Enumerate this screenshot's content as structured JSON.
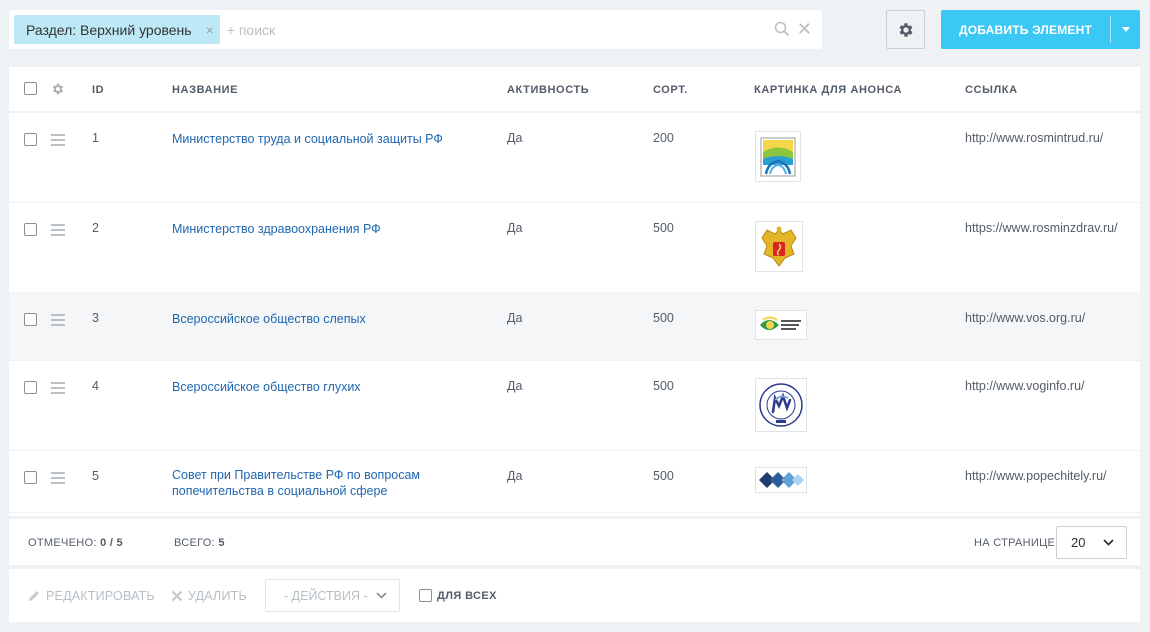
{
  "filter": {
    "chip_label": "Раздел: Верхний уровень",
    "chip_close": "×",
    "search_placeholder": "+ поиск",
    "clear": "✕"
  },
  "toolbar": {
    "add_label": "ДОБАВИТЬ ЭЛЕМЕНТ"
  },
  "columns": {
    "id": "ID",
    "name": "НАЗВАНИЕ",
    "active": "АКТИВНОСТЬ",
    "sort": "СОРТ.",
    "picture": "КАРТИНКА ДЛЯ АНОНСА",
    "link": "ССЫЛКА"
  },
  "rows": [
    {
      "id": "1",
      "name": "Министерство труда и социальной защиты РФ",
      "active": "Да",
      "sort": "200",
      "link": "http://www.rosmintrud.ru/",
      "logo": "mintrud-logo"
    },
    {
      "id": "2",
      "name": "Министерство здравоохранения РФ",
      "active": "Да",
      "sort": "500",
      "link": "https://www.rosminzdrav.ru/",
      "logo": "minzdrav-emblem"
    },
    {
      "id": "3",
      "name": "Всероссийское общество слепых",
      "active": "Да",
      "sort": "500",
      "link": "http://www.vos.org.ru/",
      "logo": "vos-logo"
    },
    {
      "id": "4",
      "name": "Всероссийское общество глухих",
      "active": "Да",
      "sort": "500",
      "link": "http://www.voginfo.ru/",
      "logo": "vog-logo"
    },
    {
      "id": "5",
      "name": "Совет при Правительстве РФ по вопросам попечительства в социальной сфере",
      "active": "Да",
      "sort": "500",
      "link": "http://www.popechitely.ru/",
      "logo": "popechitely-logo"
    }
  ],
  "footer": {
    "selected_label": "ОТМЕЧЕНО:",
    "selected_value": "0 / 5",
    "total_label": "ВСЕГО:",
    "total_value": "5",
    "per_page_label": "НА СТРАНИЦЕ:",
    "per_page_value": "20"
  },
  "actions": {
    "edit": "РЕДАКТИРОВАТЬ",
    "delete": "УДАЛИТЬ",
    "actions_select": "- ДЕЙСТВИЯ -",
    "for_all": "ДЛЯ ВСЕХ"
  },
  "colors": {
    "accent": "#3bc8f5",
    "chip": "#bde9f7",
    "link": "#2067b0"
  }
}
